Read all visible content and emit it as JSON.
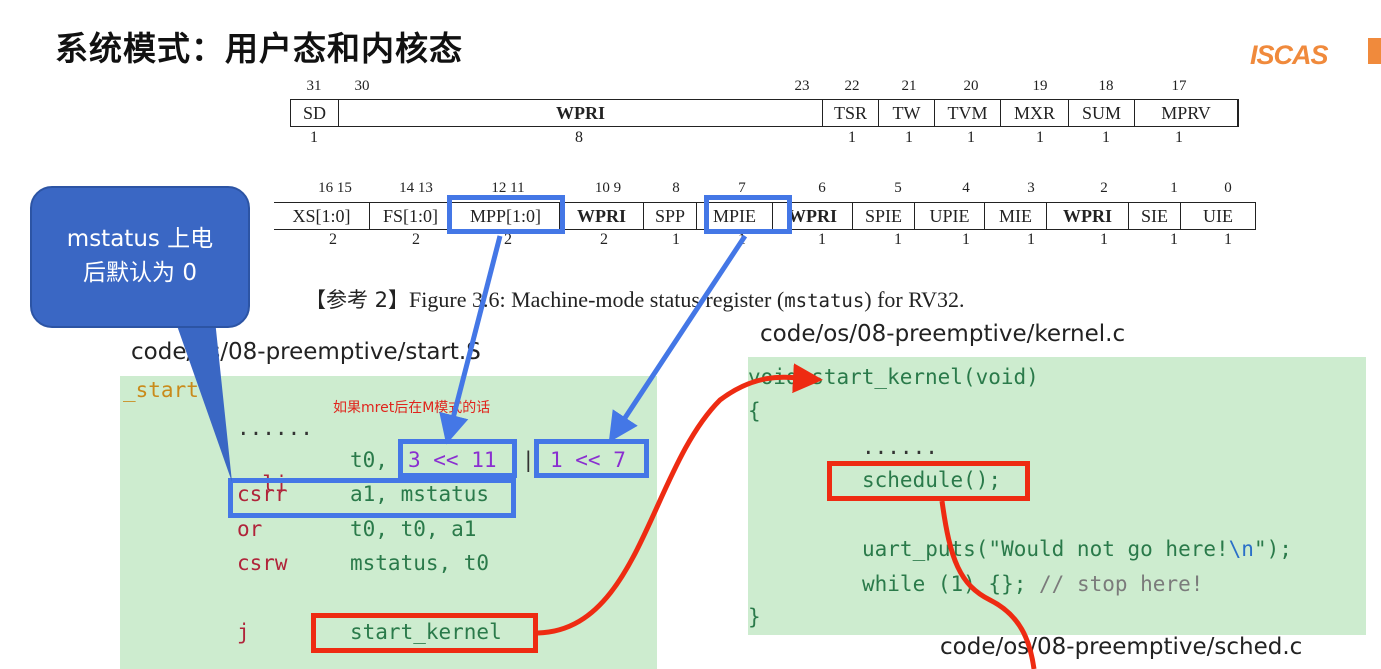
{
  "title": "系统模式：用户态和内核态",
  "logo_text": "ISCAS",
  "reg_row1": {
    "bit_labels": [
      "31",
      "30",
      "23",
      "22",
      "21",
      "20",
      "19",
      "18",
      "17"
    ],
    "fields": [
      "SD",
      "WPRI",
      "TSR",
      "TW",
      "TVM",
      "MXR",
      "SUM",
      "MPRV"
    ],
    "widths": [
      "1",
      "8",
      "1",
      "1",
      "1",
      "1",
      "1",
      "1"
    ]
  },
  "reg_row2": {
    "bit_labels": [
      "16 15",
      "14 13",
      "12 11",
      "10 9",
      "8",
      "7",
      "6",
      "5",
      "4",
      "3",
      "2",
      "1",
      "0"
    ],
    "fields": [
      "XS[1:0]",
      "FS[1:0]",
      "MPP[1:0]",
      "WPRI",
      "SPP",
      "MPIE",
      "WPRI",
      "SPIE",
      "UPIE",
      "MIE",
      "WPRI",
      "SIE",
      "UIE"
    ],
    "widths": [
      "2",
      "2",
      "2",
      "2",
      "1",
      "1",
      "1",
      "1",
      "1",
      "1",
      "1",
      "1",
      "1"
    ]
  },
  "callout": {
    "line1": "mstatus 上电",
    "line2": "后默认为 0"
  },
  "caption": {
    "prefix": "【参考 2】",
    "text": "Figure 3.6: Machine-mode status register (",
    "mono": "mstatus",
    "suffix": ") for RV32."
  },
  "start_panel": {
    "path": "code/os/08-preemptive/start.S",
    "label": "_start",
    "note": "如果mret后在M模式的话",
    "dots": "......",
    "lines": [
      {
        "op": "li",
        "args_a": "t0, ",
        "args_b": "3 << 11",
        "sep": "|",
        "args_c": "1 << 7"
      },
      {
        "op": "csrr",
        "args": "a1, mstatus"
      },
      {
        "op": "or",
        "args": "t0, t0, a1"
      },
      {
        "op": "csrw",
        "args": "mstatus, t0"
      },
      {
        "op": "j",
        "args": "start_kernel"
      }
    ]
  },
  "kernel_panel": {
    "path": "code/os/08-preemptive/kernel.c",
    "signature": "void start_kernel(void)",
    "open_brace": "{",
    "dots": "......",
    "schedule": "schedule();",
    "uart_prefix": "uart_puts(\"Would not go here!",
    "uart_escape": "\\n",
    "uart_suffix": "\");",
    "while_code": "while (1) {}; ",
    "comment": "// stop here!",
    "close_brace": "}"
  },
  "sched_path": "code/os/08-preemptive/sched.c",
  "colors": {
    "blue": "#4477e6",
    "red": "#ee2b12",
    "panel": "#cdeccf",
    "callout": "#3a67c4"
  }
}
